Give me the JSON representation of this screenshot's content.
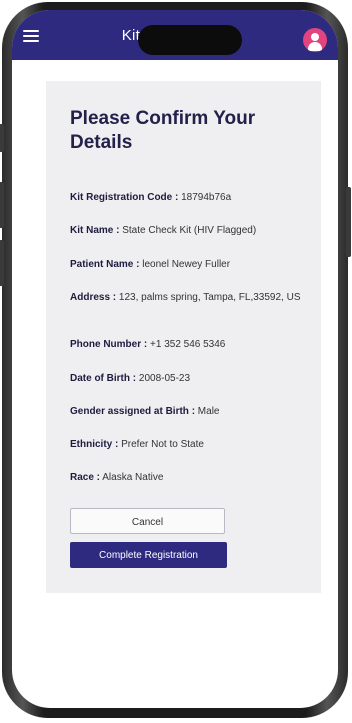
{
  "app_bar": {
    "title": "Kit Registration",
    "menu_icon": "hamburger-menu-icon",
    "avatar_icon": "user-avatar-icon",
    "color": "#2e2a80",
    "avatar_color": "#e2457e"
  },
  "card": {
    "title": "Please Confirm Your Details",
    "details": [
      {
        "label": "Kit Registration Code :",
        "value": " 18794b76a"
      },
      {
        "label": "Kit Name :",
        "value": " State Check Kit (HIV Flagged)"
      },
      {
        "label": "Patient Name :",
        "value": " leonel Newey Fuller"
      },
      {
        "label": "Address :",
        "value": " 123, palms spring, Tampa, FL,33592, US"
      },
      {
        "label": "Phone Number :",
        "value": " +1 352 546 5346"
      },
      {
        "label": "Date of Birth :",
        "value": " 2008-05-23"
      },
      {
        "label": "Gender assigned at Birth :",
        "value": " Male"
      },
      {
        "label": "Ethnicity :",
        "value": " Prefer Not to State"
      },
      {
        "label": "Race :",
        "value": " Alaska Native"
      }
    ]
  },
  "actions": {
    "cancel_label": "Cancel",
    "complete_label": "Complete Registration"
  }
}
